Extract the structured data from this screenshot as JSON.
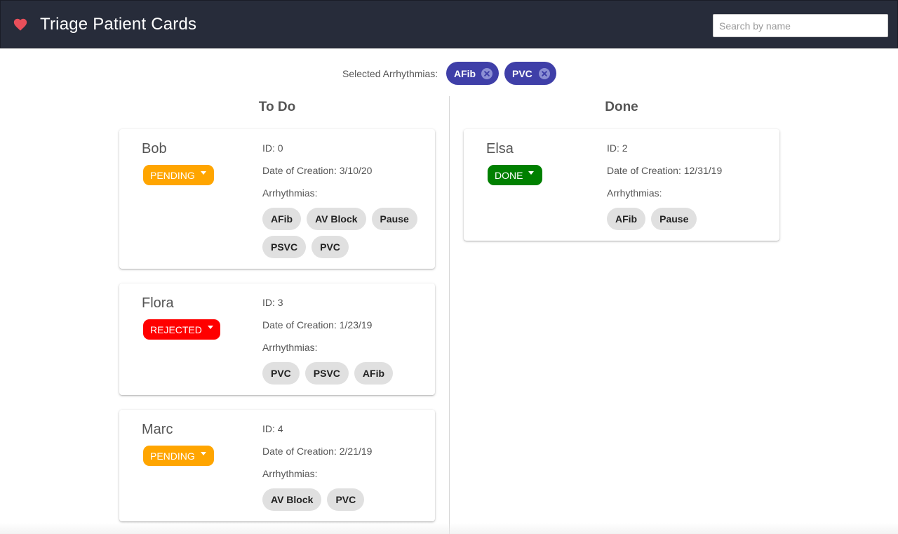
{
  "header": {
    "title": "Triage Patient Cards",
    "logo_icon": "heart-icon",
    "search_placeholder": "Search by name",
    "search_value": ""
  },
  "filter": {
    "label": "Selected Arrhythmias:",
    "selected": [
      "AFib",
      "PVC"
    ]
  },
  "labels": {
    "id_prefix": "ID:",
    "date_prefix": "Date of Creation:",
    "arrhythmias": "Arrhythmias:"
  },
  "colors": {
    "pending": "#ffa500",
    "rejected": "#ff0000",
    "done": "#008000",
    "selected_chip": "#3f3fa8",
    "app_bar": "#272c3a"
  },
  "columns": [
    {
      "title": "To Do",
      "cards": [
        {
          "name": "Bob",
          "status": "PENDING",
          "id": "0",
          "date": "3/10/20",
          "arrhythmias": [
            "AFib",
            "AV Block",
            "Pause",
            "PSVC",
            "PVC"
          ]
        },
        {
          "name": "Flora",
          "status": "REJECTED",
          "id": "3",
          "date": "1/23/19",
          "arrhythmias": [
            "PVC",
            "PSVC",
            "AFib"
          ]
        },
        {
          "name": "Marc",
          "status": "PENDING",
          "id": "4",
          "date": "2/21/19",
          "arrhythmias": [
            "AV Block",
            "PVC"
          ]
        }
      ]
    },
    {
      "title": "Done",
      "cards": [
        {
          "name": "Elsa",
          "status": "DONE",
          "id": "2",
          "date": "12/31/19",
          "arrhythmias": [
            "AFib",
            "Pause"
          ]
        }
      ]
    }
  ]
}
